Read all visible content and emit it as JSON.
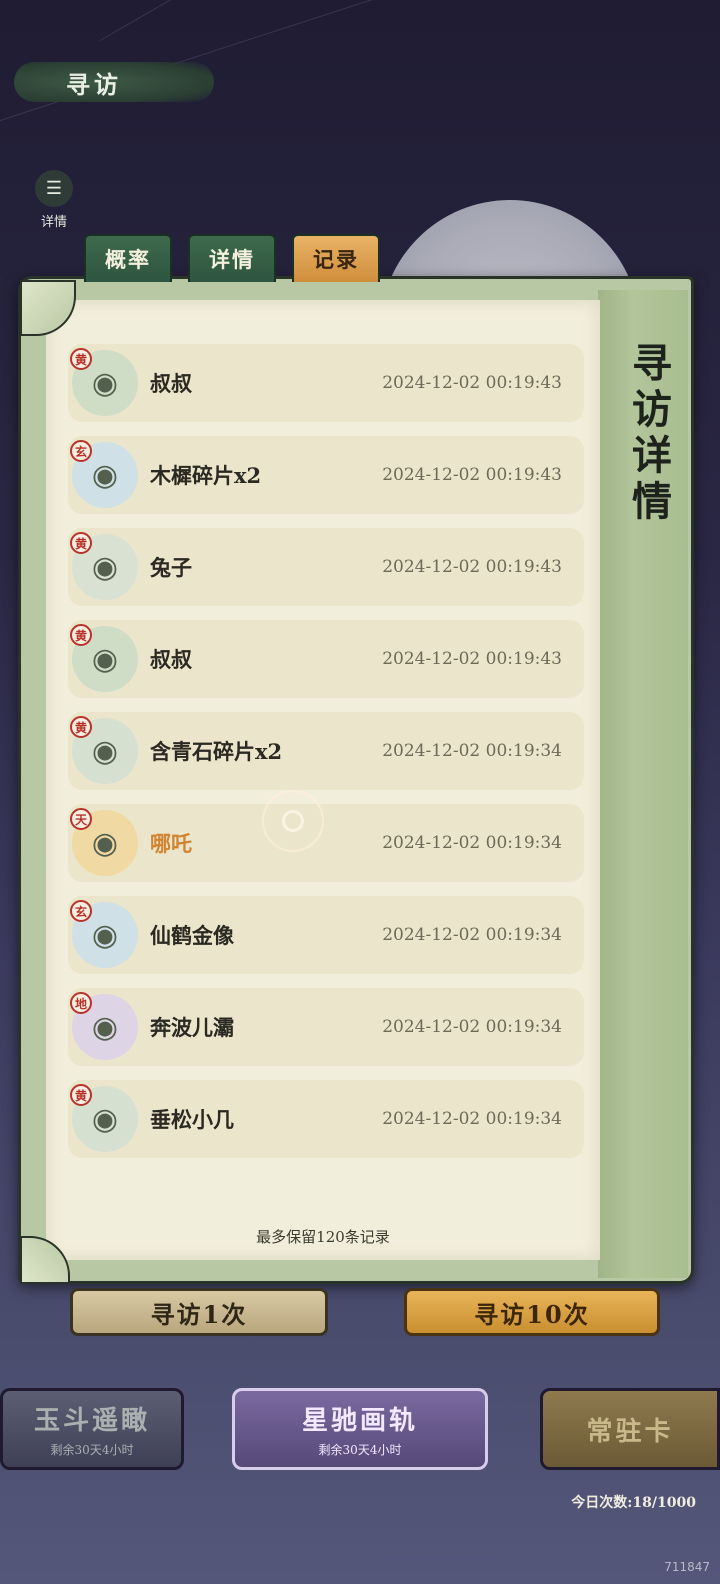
{
  "header": {
    "title": "寻访"
  },
  "detail_button": {
    "label": "详情"
  },
  "tabs": [
    {
      "label": "概率",
      "active": false
    },
    {
      "label": "详情",
      "active": false
    },
    {
      "label": "记录",
      "active": true
    }
  ],
  "panel": {
    "side_title": "寻访详情",
    "footer_note": "最多保留120条记录"
  },
  "records": [
    {
      "grade": "黄",
      "name": "叔叔",
      "time": "2024-12-02  00:19:43",
      "avatar_color": "#cfdcc6",
      "highlight": false
    },
    {
      "grade": "玄",
      "name": "木樨碎片x2",
      "time": "2024-12-02  00:19:43",
      "avatar_color": "#cfe0e6",
      "highlight": false
    },
    {
      "grade": "黄",
      "name": "兔子",
      "time": "2024-12-02  00:19:43",
      "avatar_color": "#d9e2d2",
      "highlight": false
    },
    {
      "grade": "黄",
      "name": "叔叔",
      "time": "2024-12-02  00:19:43",
      "avatar_color": "#cfdcc6",
      "highlight": false
    },
    {
      "grade": "黄",
      "name": "含青石碎片x2",
      "time": "2024-12-02  00:19:34",
      "avatar_color": "#d6e0d0",
      "highlight": false
    },
    {
      "grade": "天",
      "name": "哪吒",
      "time": "2024-12-02  00:19:34",
      "avatar_color": "#f0d9a2",
      "highlight": true
    },
    {
      "grade": "玄",
      "name": "仙鹤金像",
      "time": "2024-12-02  00:19:34",
      "avatar_color": "#cfe0e6",
      "highlight": false
    },
    {
      "grade": "地",
      "name": "奔波儿灞",
      "time": "2024-12-02  00:19:34",
      "avatar_color": "#ddd4e6",
      "highlight": false
    },
    {
      "grade": "黄",
      "name": "垂松小几",
      "time": "2024-12-02  00:19:34",
      "avatar_color": "#d6e0d0",
      "highlight": false
    }
  ],
  "draw_buttons": {
    "single": "寻访1次",
    "ten": "寻访10次"
  },
  "banners": [
    {
      "title": "玉斗遥瞰",
      "sub": "剩余30天4小时"
    },
    {
      "title": "星驰画轨",
      "sub": "剩余30天4小时"
    },
    {
      "title": "常驻卡",
      "sub": ""
    }
  ],
  "today_count": "今日次数:18/1000",
  "build_id": "711847"
}
